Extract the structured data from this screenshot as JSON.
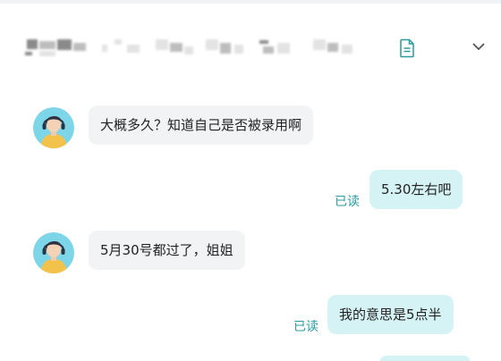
{
  "conversation": {
    "contact_name_obscured": "",
    "icons": {
      "file": "file-document-icon",
      "collapse": "chevron-down-icon"
    },
    "colors": {
      "accent": "#2a9a9f",
      "incoming_bubble": "#f2f3f5",
      "outgoing_bubble": "#d5f3f5",
      "avatar_bg": "#7dd6e8",
      "avatar_shirt": "#f3c24a"
    }
  },
  "messages": [
    {
      "direction": "incoming",
      "text": "大概多久？知道自己是否被录用啊"
    },
    {
      "direction": "outgoing",
      "text": "5.30左右吧",
      "status": "已读"
    },
    {
      "direction": "incoming",
      "text": "5月30号都过了，姐姐"
    },
    {
      "direction": "outgoing",
      "text": "我的意思是5点半",
      "status": "已读"
    }
  ]
}
